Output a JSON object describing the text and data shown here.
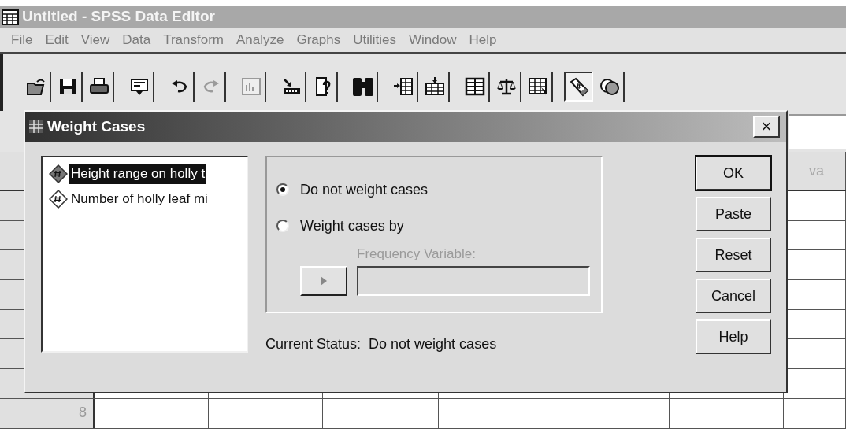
{
  "window": {
    "title": "Untitled - SPSS Data Editor"
  },
  "menu": [
    "File",
    "Edit",
    "View",
    "Data",
    "Transform",
    "Analyze",
    "Graphs",
    "Utilities",
    "Window",
    "Help"
  ],
  "toolbar": [
    {
      "kind": "open",
      "pressed": false,
      "disabled": false
    },
    {
      "kind": "save",
      "pressed": false,
      "disabled": false
    },
    {
      "kind": "print",
      "pressed": false,
      "disabled": false
    },
    {
      "kind": "recall",
      "pressed": false,
      "disabled": false
    },
    {
      "kind": "undo",
      "pressed": false,
      "disabled": false
    },
    {
      "kind": "redo",
      "pressed": false,
      "disabled": true
    },
    {
      "kind": "chart",
      "pressed": false,
      "disabled": true
    },
    {
      "kind": "goto",
      "pressed": false,
      "disabled": false
    },
    {
      "kind": "variables",
      "pressed": false,
      "disabled": false
    },
    {
      "kind": "find",
      "pressed": false,
      "disabled": false
    },
    {
      "kind": "insert_case",
      "pressed": false,
      "disabled": false
    },
    {
      "kind": "insert_variable",
      "pressed": false,
      "disabled": false
    },
    {
      "kind": "split",
      "pressed": false,
      "disabled": false
    },
    {
      "kind": "weight",
      "pressed": false,
      "disabled": false
    },
    {
      "kind": "select",
      "pressed": false,
      "disabled": false
    },
    {
      "kind": "labels",
      "pressed": true,
      "disabled": false
    },
    {
      "kind": "sets",
      "pressed": false,
      "disabled": false
    }
  ],
  "grid": {
    "column_header": "va",
    "row_labels": [
      "8"
    ]
  },
  "dialog": {
    "title": "Weight Cases",
    "close": "×",
    "variables": [
      {
        "label": "Height range on holly t",
        "selected": true
      },
      {
        "label": "Number of holly leaf mi",
        "selected": false
      }
    ],
    "options": [
      {
        "label": "Do not weight cases",
        "selected": true
      },
      {
        "label": "Weight cases by",
        "selected": false
      }
    ],
    "frequency_label": "Frequency Variable:",
    "frequency_disabled": true,
    "status": "Current Status:  Do not weight cases",
    "buttons": [
      {
        "label": "OK",
        "default": true
      },
      {
        "label": "Paste",
        "default": false
      },
      {
        "label": "Reset",
        "default": false
      },
      {
        "label": "Cancel",
        "default": false
      },
      {
        "label": "Help",
        "default": false
      }
    ]
  }
}
